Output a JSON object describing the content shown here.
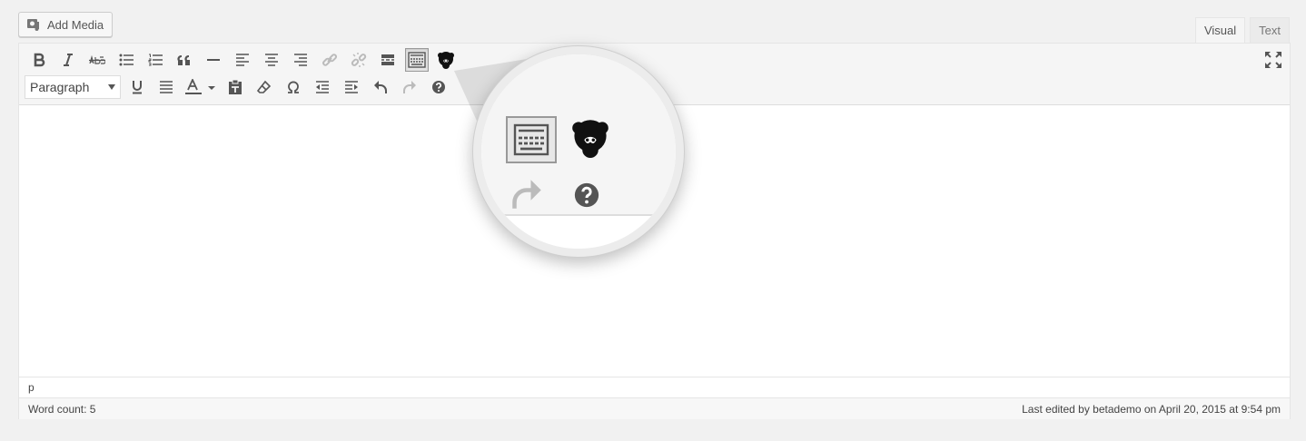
{
  "add_media": {
    "label": "Add Media",
    "icon": "media-icon"
  },
  "tabs": [
    {
      "label": "Visual",
      "active": true
    },
    {
      "label": "Text",
      "active": false
    }
  ],
  "toolbar": {
    "row1": [
      "bold",
      "italic",
      "strikethrough",
      "bulleted-list",
      "numbered-list",
      "blockquote",
      "horizontal-line",
      "align-left",
      "align-center",
      "align-right",
      "insert-link",
      "remove-link",
      "read-more",
      "toolbar-toggle",
      "ape-plugin"
    ],
    "format_select": "Paragraph",
    "row2": [
      "underline",
      "justify",
      "text-color",
      "paste-as-text",
      "clear-formatting",
      "special-character",
      "decrease-indent",
      "increase-indent",
      "undo",
      "redo",
      "keyboard-shortcuts"
    ]
  },
  "path": "p",
  "status": {
    "word_count": "Word count: 5",
    "last_edited": "Last edited by betademo on April 20, 2015 at 9:54 pm"
  },
  "magnifier": {
    "icons": [
      "keyboard-icon",
      "ape-icon",
      "redo-icon",
      "help-icon"
    ]
  },
  "colors": {
    "background": "#f1f1f1",
    "toolbar": "#f5f5f5",
    "icon": "#555555",
    "disabled_icon": "#bbbbbb"
  }
}
